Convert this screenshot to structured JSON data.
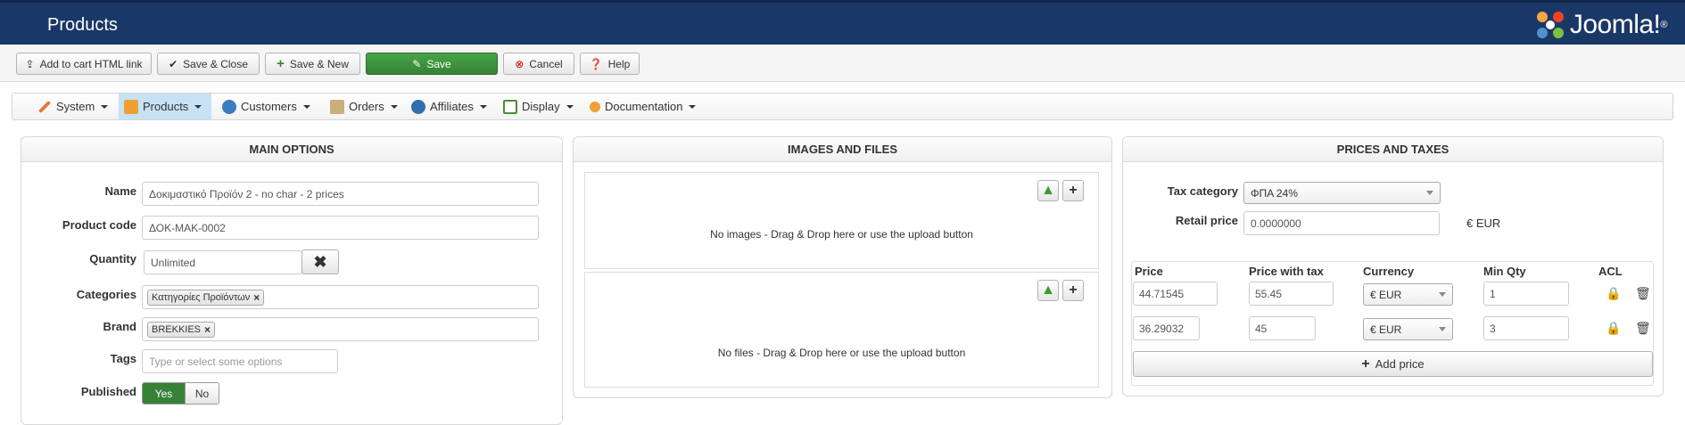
{
  "header": {
    "title": "Products",
    "logo_text": "Joomla!",
    "logo_mark": "®"
  },
  "toolbar": {
    "add_to_cart_label": "Add to cart HTML link",
    "save_close_label": "Save & Close",
    "save_new_label": "Save & New",
    "save_label": "Save",
    "cancel_label": "Cancel",
    "help_label": "Help"
  },
  "nav": {
    "items": [
      {
        "label": "System",
        "icon": "wrench-icon"
      },
      {
        "label": "Products",
        "icon": "box-icon"
      },
      {
        "label": "Customers",
        "icon": "users-icon"
      },
      {
        "label": "Orders",
        "icon": "orders-icon"
      },
      {
        "label": "Affiliates",
        "icon": "affiliates-icon"
      },
      {
        "label": "Display",
        "icon": "display-icon"
      },
      {
        "label": "Documentation",
        "icon": "documentation-icon"
      }
    ],
    "active": "Products"
  },
  "main_options": {
    "title": "MAIN OPTIONS",
    "name_label": "Name",
    "name_value": "Δοκιμαστικό Προϊόν 2 - no char - 2 prices",
    "code_label": "Product code",
    "code_value": "ΔΟΚ-ΜΑΚ-0002",
    "quantity_label": "Quantity",
    "quantity_value": "Unlimited",
    "categories_label": "Categories",
    "categories_tag": "Κατηγορίες Προϊόντων",
    "brand_label": "Brand",
    "brand_tag": "BREKKIES",
    "tags_label": "Tags",
    "tags_placeholder": "Type or select some options",
    "published_label": "Published",
    "yes_label": "Yes",
    "no_label": "No",
    "published_value": "Yes"
  },
  "images_files": {
    "title": "IMAGES AND FILES",
    "images_msg": "No images - Drag & Drop here or use the upload button",
    "files_msg": "No files - Drag & Drop here or use the upload button"
  },
  "prices": {
    "title": "PRICES AND TAXES",
    "tax_category_label": "Tax category",
    "tax_category_value": "ΦΠΑ 24%",
    "retail_price_label": "Retail price",
    "retail_price_value": "0.0000000",
    "retail_currency": "€ EUR",
    "columns": {
      "price": "Price",
      "price_with_tax": "Price with tax",
      "currency": "Currency",
      "min_qty": "Min Qty",
      "acl": "ACL"
    },
    "rows": [
      {
        "price": "44.71545",
        "price_with_tax": "55.45",
        "currency": "€ EUR",
        "min_qty": "1"
      },
      {
        "price": "36.29032",
        "price_with_tax": "45",
        "currency": "€ EUR",
        "min_qty": "3"
      }
    ],
    "add_price_label": "Add price"
  }
}
